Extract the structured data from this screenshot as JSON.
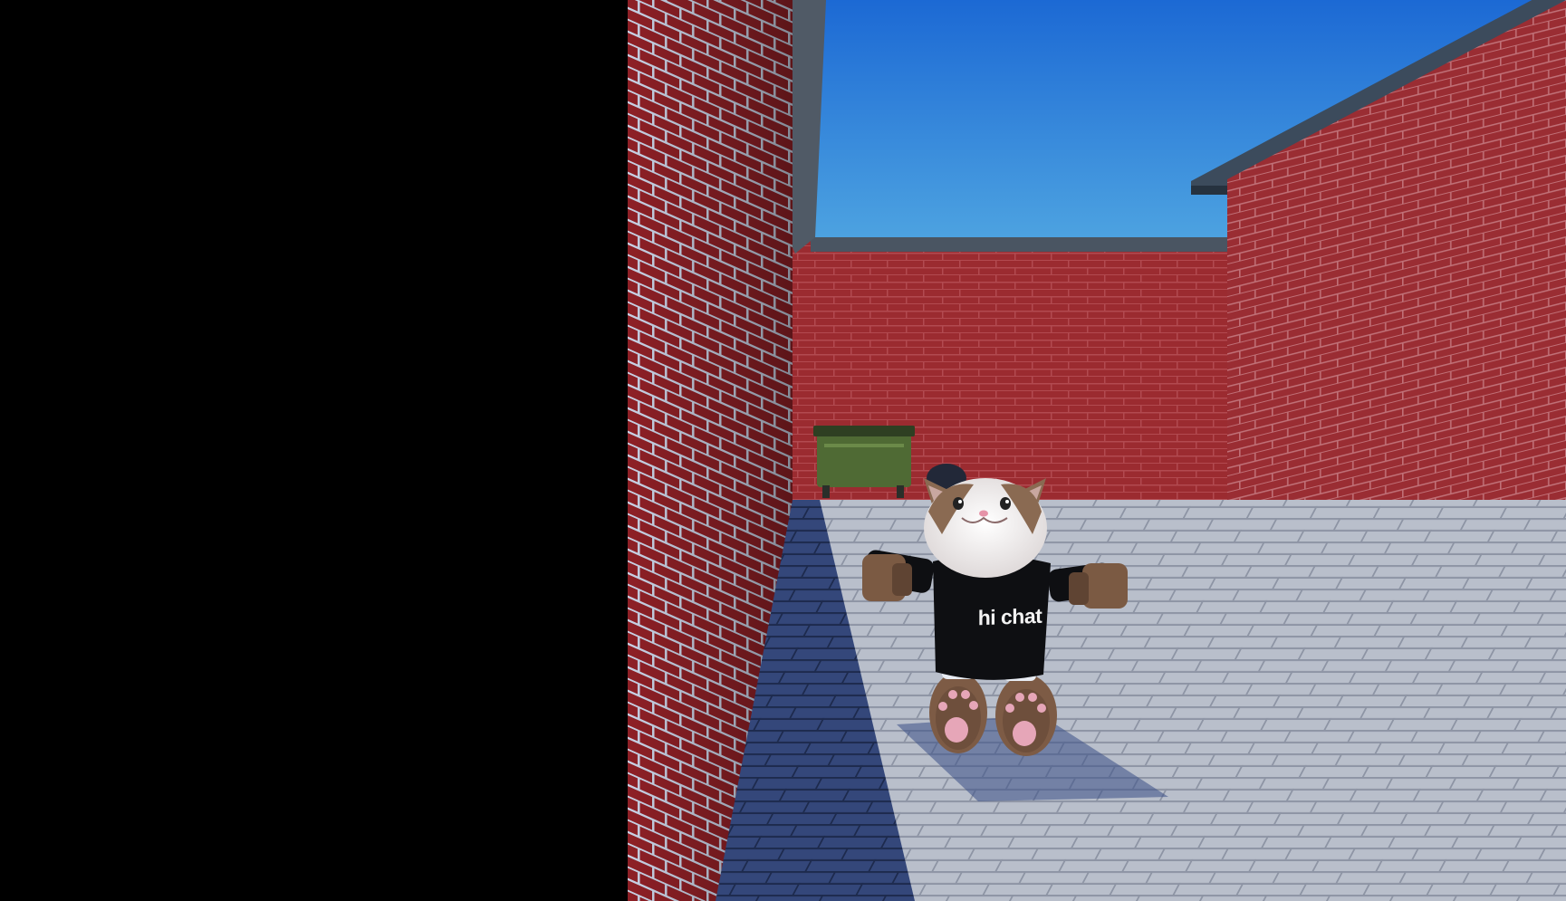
{
  "scene": {
    "description_free": true,
    "palette": {
      "sky_top": "#1f6fd6",
      "sky_bottom": "#4fa6e2",
      "brick": "#9a2a2e",
      "brick_dark": "#6e1c22",
      "mortar": "#b9c2d6",
      "pavement": "#b7bcc8",
      "pavement_shadow": "#2e3f6e",
      "dumpster": "#4f6b34"
    }
  },
  "character": {
    "shirt_text": "hi chat",
    "shirt_color": "#0e0f12",
    "head_color": "#f3eeee",
    "fur_color": "#8a6a52"
  }
}
